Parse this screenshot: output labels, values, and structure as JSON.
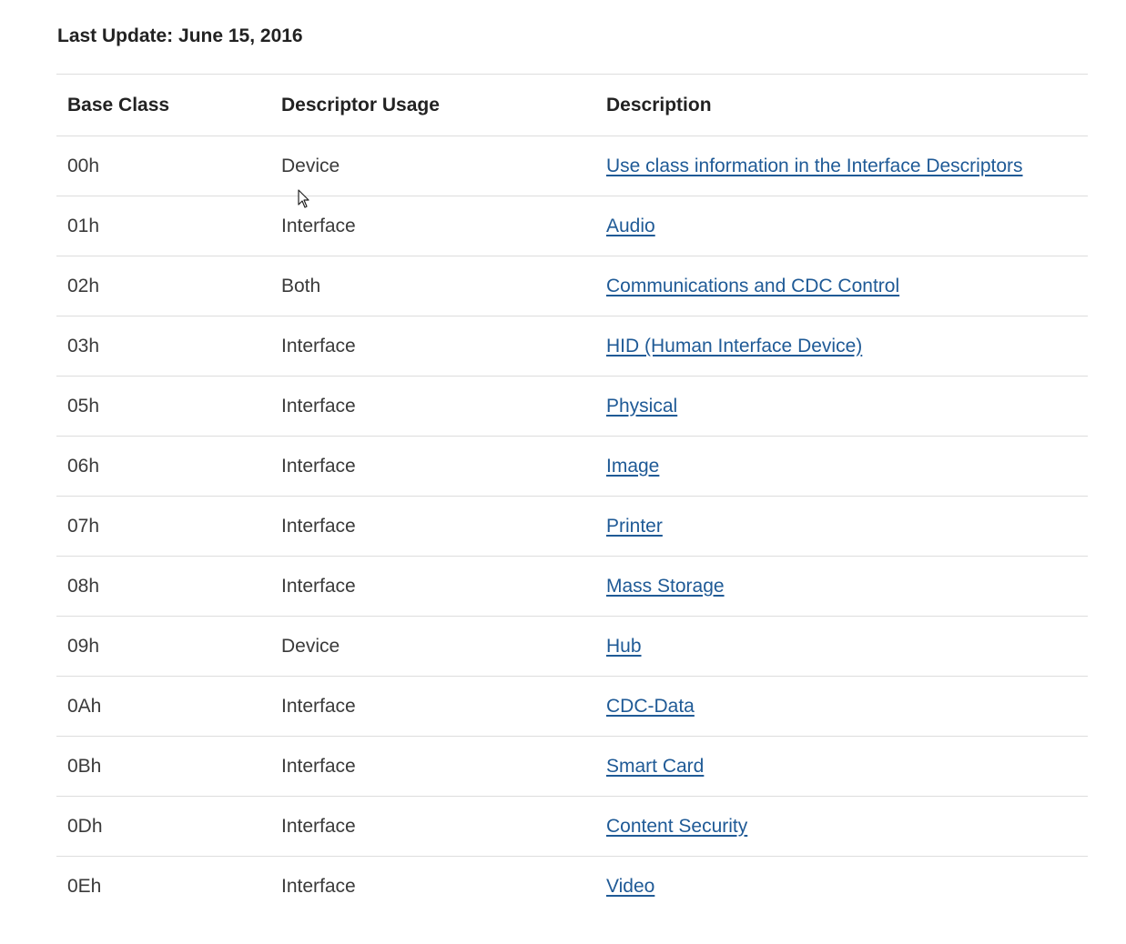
{
  "header": {
    "last_update": "Last Update: June 15, 2016"
  },
  "table": {
    "columns": [
      "Base Class",
      "Descriptor Usage",
      "Description"
    ],
    "rows": [
      {
        "base_class": "00h",
        "usage": "Device",
        "description": "Use class information in the Interface Descriptors"
      },
      {
        "base_class": "01h",
        "usage": "Interface",
        "description": "Audio"
      },
      {
        "base_class": "02h",
        "usage": "Both",
        "description": "Communications and CDC Control"
      },
      {
        "base_class": "03h",
        "usage": "Interface",
        "description": "HID (Human Interface Device)"
      },
      {
        "base_class": "05h",
        "usage": "Interface",
        "description": "Physical"
      },
      {
        "base_class": "06h",
        "usage": "Interface",
        "description": "Image"
      },
      {
        "base_class": "07h",
        "usage": "Interface",
        "description": "Printer"
      },
      {
        "base_class": "08h",
        "usage": "Interface",
        "description": "Mass Storage"
      },
      {
        "base_class": "09h",
        "usage": "Device",
        "description": "Hub"
      },
      {
        "base_class": "0Ah",
        "usage": "Interface",
        "description": "CDC-Data"
      },
      {
        "base_class": "0Bh",
        "usage": "Interface",
        "description": "Smart Card"
      },
      {
        "base_class": "0Dh",
        "usage": "Interface",
        "description": "Content Security"
      },
      {
        "base_class": "0Eh",
        "usage": "Interface",
        "description": "Video"
      }
    ]
  },
  "colors": {
    "link": "#1f5a96",
    "text": "#3a3a3a",
    "divider": "#dddddd"
  },
  "icons": {
    "cursor": "mouse-pointer-icon"
  }
}
